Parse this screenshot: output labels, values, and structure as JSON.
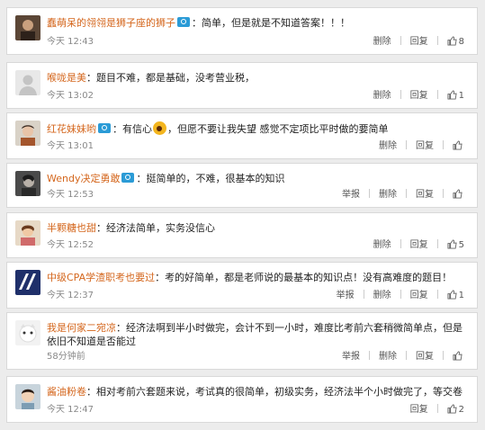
{
  "comments": [
    {
      "name": "蠢萌呆的翎翎是狮子座的狮子",
      "verified": true,
      "text": "：简单，但是就是不知道答案！！！",
      "time": "今天 12:43",
      "actions": [
        "删除",
        "回复"
      ],
      "likes": "8"
    },
    {
      "name": "喉咙是美",
      "verified": false,
      "text": "：题目不难，都是基础，没考营业税，",
      "time": "今天 13:02",
      "actions": [
        "删除",
        "回复"
      ],
      "likes": "1"
    },
    {
      "name": "红花妹妹哟",
      "verified": true,
      "text_before": "：有信心",
      "text_after": "，但愿不要让我失望 感觉不定项比平时做的要简单",
      "time": "今天 13:01",
      "actions": [
        "删除",
        "回复"
      ],
      "likes": ""
    },
    {
      "name": "Wendy决定勇敢",
      "verified": true,
      "text": "：挺简单的，不难，很基本的知识",
      "time": "今天 12:53",
      "actions": [
        "举报",
        "删除",
        "回复"
      ],
      "likes": ""
    },
    {
      "name": "半颗糖也甜",
      "verified": false,
      "text": "：经济法简单，实务没信心",
      "time": "今天 12:52",
      "actions": [
        "删除",
        "回复"
      ],
      "likes": "5"
    },
    {
      "name": "中级CPA学渣职考也要过",
      "verified": false,
      "text": "：考的好简单，都是老师说的最基本的知识点！没有高难度的题目！",
      "time": "今天 12:37",
      "actions": [
        "举报",
        "删除",
        "回复"
      ],
      "likes": "1"
    },
    {
      "name": "我是何家二宛凉",
      "verified": false,
      "text": "：经济法啊到半小时做完，会计不到一小时，难度比考前六套稍微简单点，但是依旧不知道是否能过",
      "time": "58分钟前",
      "actions": [
        "举报",
        "删除",
        "回复"
      ],
      "likes": ""
    },
    {
      "name": "酱油粉卷",
      "verified": false,
      "text": "：相对考前六套题来说，考试真的很简单，初级实务，经济法半个小时做完了，等交卷",
      "time": "今天 12:47",
      "actions": [
        "回复"
      ],
      "likes": "2"
    }
  ],
  "colors": {
    "username": "#d4661c",
    "verified_badge": "#2b9bd6",
    "text": "#222222",
    "meta": "#888888",
    "card_border": "#d9d9d9",
    "background": "#ececec"
  },
  "icons": {
    "verified": "verified-badge-icon",
    "like": "thumbs-up-icon",
    "emoji": "laughing-emoji-icon"
  }
}
